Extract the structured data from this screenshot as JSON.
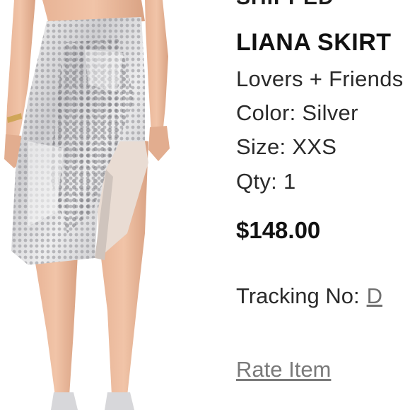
{
  "order": {
    "status": "SHIPPED",
    "item": {
      "title": "LIANA SKIRT",
      "brand": "Lovers + Friends",
      "color_line": "Color: Silver",
      "size_line": "Size: XXS",
      "qty_line": "Qty: 1",
      "price": "$148.00"
    },
    "tracking_label": "Tracking No:",
    "tracking_value": "D",
    "rate_label": "Rate Item"
  }
}
